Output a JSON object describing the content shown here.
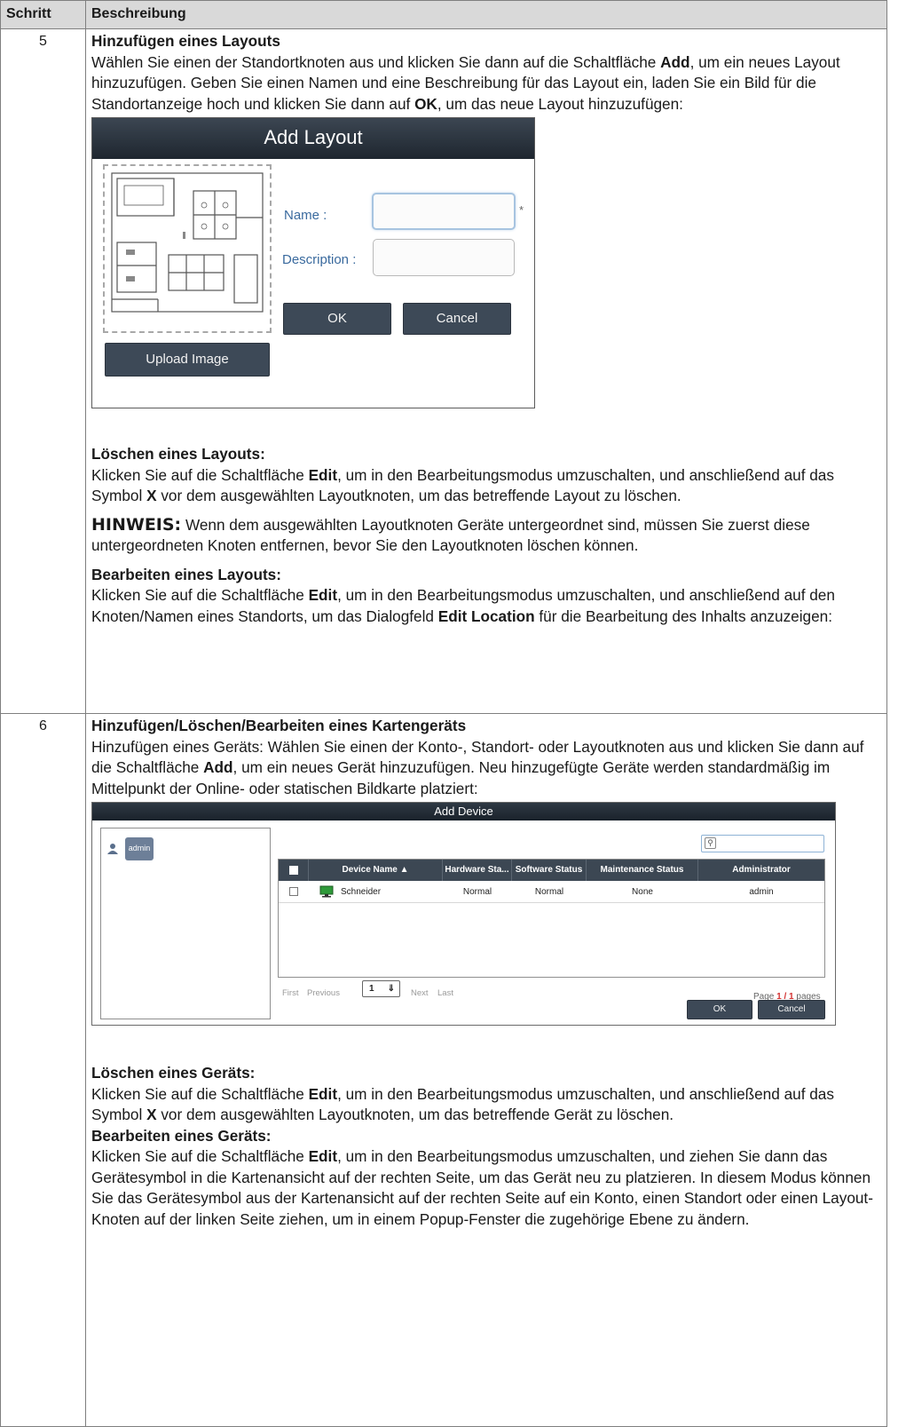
{
  "table": {
    "col_step": "Schritt",
    "col_desc": "Beschreibung"
  },
  "step5": {
    "number": "5",
    "heading": "Hinzufügen eines Layouts",
    "intro_a": "Wählen Sie einen der Standortknoten aus und klicken Sie dann auf die Schaltfläche ",
    "intro_add": "Add",
    "intro_b": ", um ein neues Layout hinzuzufügen. Geben Sie einen Namen und eine Beschreibung für das Layout ein, laden Sie ein Bild für die Standortanzeige hoch und klicken Sie dann auf ",
    "intro_ok": "OK",
    "intro_c": ", um das neue Layout hinzuzufügen:",
    "dialog": {
      "title": "Add Layout",
      "name_label": "Name :",
      "description_label": "Description :",
      "required_mark": "*",
      "ok": "OK",
      "cancel": "Cancel",
      "upload": "Upload Image"
    },
    "delete_heading": "Löschen eines Layouts:",
    "delete_a": "Klicken Sie auf die Schaltfläche ",
    "delete_edit": "Edit",
    "delete_b": ", um in den Bearbeitungsmodus umzuschalten, und anschließend auf das Symbol ",
    "delete_x": "X",
    "delete_c": " vor dem ausgewählten Layoutknoten, um das betreffende Layout zu löschen.",
    "note_label": "HINWEIS:",
    "note_text": " Wenn dem ausgewählten Layoutknoten Geräte untergeordnet sind, müssen Sie zuerst diese untergeordneten Knoten entfernen, bevor Sie den Layoutknoten löschen können.",
    "edit_heading": "Bearbeiten eines Layouts:",
    "edit_a": "Klicken Sie auf die Schaltfläche ",
    "edit_edit": "Edit",
    "edit_b": ", um in den Bearbeitungsmodus umzuschalten, und anschließend auf den Knoten/Namen eines Standorts, um das Dialogfeld ",
    "edit_location": "Edit Location",
    "edit_c": " für die Bearbeitung des Inhalts anzuzeigen:"
  },
  "step6": {
    "number": "6",
    "heading": "Hinzufügen/Löschen/Bearbeiten eines Kartengeräts",
    "intro_a": "Hinzufügen eines Geräts: Wählen Sie einen der Konto-, Standort- oder Layoutknoten aus und klicken Sie dann auf die Schaltfläche ",
    "intro_add": "Add",
    "intro_b": ", um ein neues Gerät hinzuzufügen. Neu hinzugefügte Geräte werden standardmäßig im Mittelpunkt der Online- oder statischen Bildkarte platziert:",
    "dialog": {
      "title": "Add Device",
      "tree_user": "admin",
      "columns": [
        "Device Name ▲",
        "Hardware Sta...",
        "Software Status",
        "Maintenance Status",
        "Administrator"
      ],
      "rows": [
        {
          "name": "Schneider",
          "hardware": "Normal",
          "software": "Normal",
          "maintenance": "None",
          "admin": "admin"
        }
      ],
      "pager": {
        "first": "First",
        "previous": "Previous",
        "page_value": "1",
        "next": "Next",
        "last": "Last",
        "page_prefix": "Page ",
        "page_current": "1 / 1",
        "page_suffix": " pages"
      },
      "ok": "OK",
      "cancel": "Cancel"
    },
    "delete_heading": "Löschen eines Geräts:",
    "delete_a": "Klicken Sie auf die Schaltfläche ",
    "delete_edit": "Edit",
    "delete_b": ", um in den Bearbeitungsmodus umzuschalten, und anschließend auf das Symbol ",
    "delete_x": "X",
    "delete_c": " vor dem ausgewählten Layoutknoten, um das betreffende Gerät zu löschen.",
    "edit_heading": "Bearbeiten eines Geräts:",
    "edit_a": "Klicken Sie auf die Schaltfläche ",
    "edit_edit": "Edit",
    "edit_b": ", um in den Bearbeitungsmodus umzuschalten, und ziehen Sie dann das Gerätesymbol in die Kartenansicht auf der rechten Seite, um das Gerät neu zu platzieren. In diesem Modus können Sie das Gerätesymbol aus der Kartenansicht auf der rechten Seite auf ein Konto, einen Standort oder einen Layout-Knoten auf der linken Seite ziehen, um in einem Popup-Fenster die zugehörige Ebene zu ändern."
  }
}
